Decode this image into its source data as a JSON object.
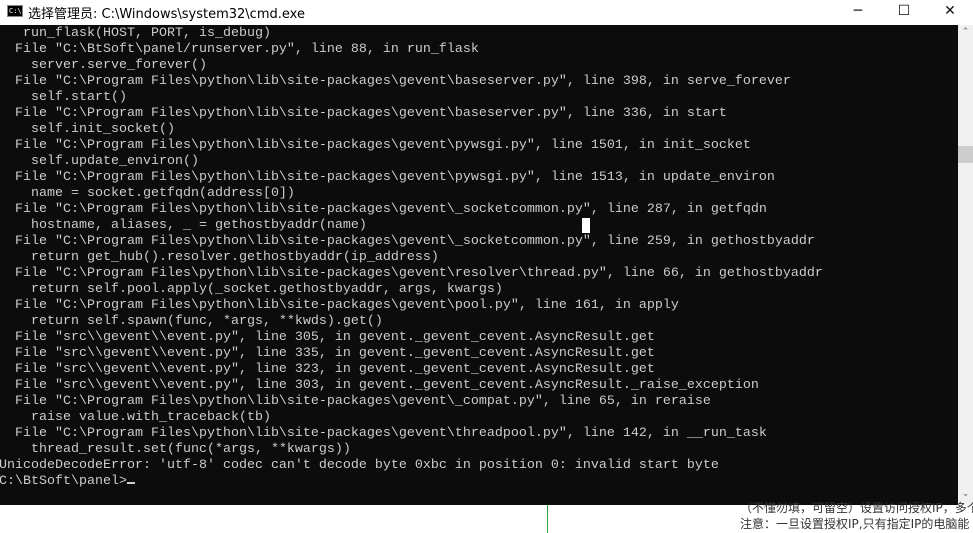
{
  "window": {
    "title": "选择管理员: C:\\Windows\\system32\\cmd.exe",
    "icon": "cmd-icon",
    "minimize": "─",
    "maximize": "☐",
    "close": "✕"
  },
  "console": {
    "lines": [
      "   run_flask(HOST, PORT, is_debug)",
      "  File \"C:\\BtSoft\\panel/runserver.py\", line 88, in run_flask",
      "    server.serve_forever()",
      "  File \"C:\\Program Files\\python\\lib\\site-packages\\gevent\\baseserver.py\", line 398, in serve_forever",
      "    self.start()",
      "  File \"C:\\Program Files\\python\\lib\\site-packages\\gevent\\baseserver.py\", line 336, in start",
      "    self.init_socket()",
      "  File \"C:\\Program Files\\python\\lib\\site-packages\\gevent\\pywsgi.py\", line 1501, in init_socket",
      "    self.update_environ()",
      "  File \"C:\\Program Files\\python\\lib\\site-packages\\gevent\\pywsgi.py\", line 1513, in update_environ",
      "    name = socket.getfqdn(address[0])",
      "  File \"C:\\Program Files\\python\\lib\\site-packages\\gevent\\_socketcommon.py\", line 287, in getfqdn",
      "    hostname, aliases, _ = gethostbyaddr(name)",
      "  File \"C:\\Program Files\\python\\lib\\site-packages\\gevent\\_socketcommon.py\", line 259, in gethostbyaddr",
      "    return get_hub().resolver.gethostbyaddr(ip_address)",
      "  File \"C:\\Program Files\\python\\lib\\site-packages\\gevent\\resolver\\thread.py\", line 66, in gethostbyaddr",
      "    return self.pool.apply(_socket.gethostbyaddr, args, kwargs)",
      "  File \"C:\\Program Files\\python\\lib\\site-packages\\gevent\\pool.py\", line 161, in apply",
      "    return self.spawn(func, *args, **kwds).get()",
      "  File \"src\\\\gevent\\\\event.py\", line 305, in gevent._gevent_cevent.AsyncResult.get",
      "  File \"src\\\\gevent\\\\event.py\", line 335, in gevent._gevent_cevent.AsyncResult.get",
      "  File \"src\\\\gevent\\\\event.py\", line 323, in gevent._gevent_cevent.AsyncResult.get",
      "  File \"src\\\\gevent\\\\event.py\", line 303, in gevent._gevent_cevent.AsyncResult._raise_exception",
      "  File \"C:\\Program Files\\python\\lib\\site-packages\\gevent\\_compat.py\", line 65, in reraise",
      "    raise value.with_traceback(tb)",
      "  File \"C:\\Program Files\\python\\lib\\site-packages\\gevent\\threadpool.py\", line 142, in __run_task",
      "    thread_result.set(func(*args, **kwargs))",
      "UnicodeDecodeError: 'utf-8' codec can't decode byte 0xbc in position 0: invalid start byte"
    ],
    "prompt": "C:\\BtSoft\\panel>"
  },
  "scrollbar": {
    "up": "⌃",
    "down": "⌄"
  },
  "background": {
    "line1": "（不懂勿填，可留空）设置访问授权IP，多个IP",
    "line2": "注意：一旦设置授权IP,只有指定IP的电脑能"
  }
}
